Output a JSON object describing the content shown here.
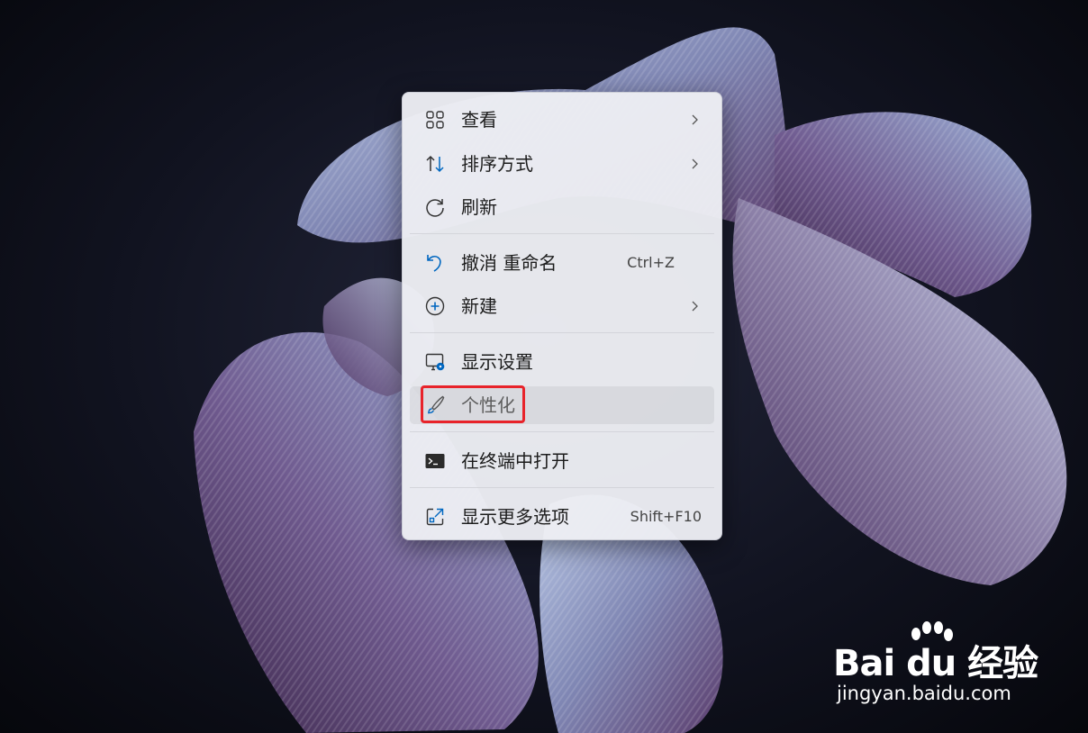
{
  "desktop": {
    "wallpaper": "windows-11-bloom-ribbon",
    "colors": {
      "background": "#111320",
      "ribbon_light": "#9fb4d8",
      "ribbon_dark": "#6a4a78"
    }
  },
  "context_menu": {
    "items": [
      {
        "label": "查看",
        "icon": "grid-view-icon",
        "submenu": true
      },
      {
        "label": "排序方式",
        "icon": "sort-arrows-icon",
        "submenu": true
      },
      {
        "label": "刷新",
        "icon": "refresh-icon"
      },
      {
        "label": "撤消 重命名",
        "icon": "undo-icon",
        "shortcut": "Ctrl+Z"
      },
      {
        "label": "新建",
        "icon": "add-circle-icon",
        "submenu": true
      },
      {
        "label": "显示设置",
        "icon": "display-settings-icon"
      },
      {
        "label": "个性化",
        "icon": "paintbrush-icon",
        "hovered": true,
        "highlighted": true
      },
      {
        "label": "在终端中打开",
        "icon": "terminal-icon"
      },
      {
        "label": "显示更多选项",
        "icon": "open-external-icon",
        "shortcut": "Shift+F10"
      }
    ],
    "colors": {
      "accent": "#0067c0",
      "highlight_border": "#e8232a"
    }
  },
  "watermark": {
    "brand": "Bai du 经验",
    "url": "jingyan.baidu.com"
  }
}
